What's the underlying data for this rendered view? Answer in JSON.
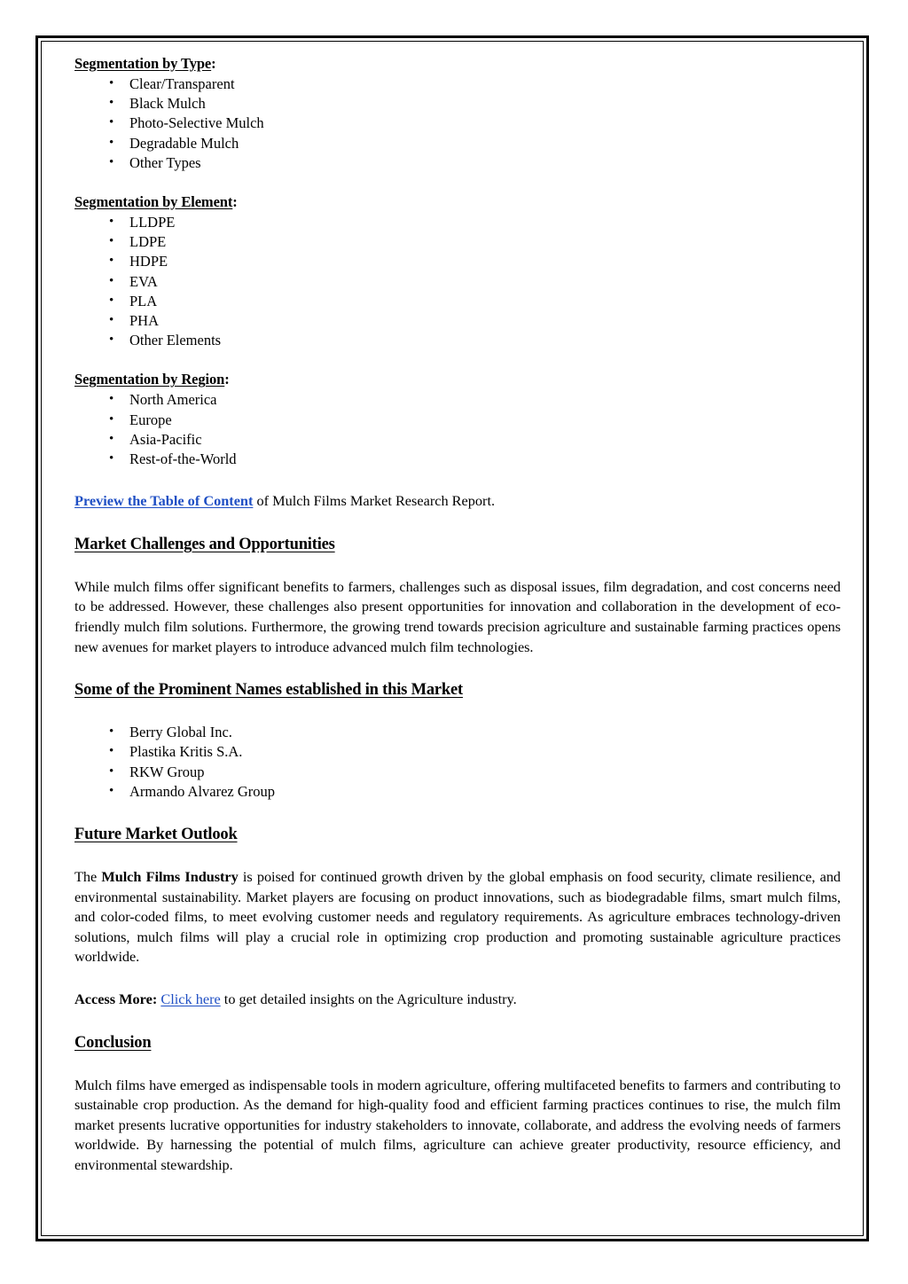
{
  "document": {
    "segmentation_type": {
      "heading": "Segmentation by Type",
      "heading_suffix": ":",
      "items": [
        "Clear/Transparent",
        "Black Mulch",
        "Photo-Selective Mulch",
        "Degradable Mulch",
        "Other Types"
      ]
    },
    "segmentation_element": {
      "heading": "Segmentation by Element",
      "heading_suffix": ":",
      "items": [
        "LLDPE",
        "LDPE",
        "HDPE",
        "EVA",
        "PLA",
        "PHA",
        "Other Elements"
      ]
    },
    "segmentation_region": {
      "heading": "Segmentation by Region",
      "heading_suffix": ":",
      "items": [
        "North America",
        "Europe",
        "Asia-Pacific",
        "Rest-of-the-World"
      ]
    },
    "preview_line": {
      "link_text": "Preview the Table of Content",
      "rest": " of Mulch Films Market Research Report."
    },
    "challenges": {
      "heading": "Market Challenges and Opportunities",
      "paragraph": "While mulch films offer significant benefits to farmers, challenges such as disposal issues, film degradation, and cost concerns need to be addressed. However, these challenges also present opportunities for innovation and collaboration in the development of eco-friendly mulch film solutions. Furthermore, the growing trend towards precision agriculture and sustainable farming practices opens new avenues for market players to introduce advanced mulch film technologies."
    },
    "prominent_names": {
      "heading": "Some of the Prominent Names established in this Market",
      "items": [
        "Berry Global Inc.",
        "Plastika Kritis S.A.",
        "RKW Group",
        "Armando Alvarez Group"
      ]
    },
    "future_outlook": {
      "heading": "Future Market Outlook",
      "paragraph_lead": "The ",
      "paragraph_bold": "Mulch Films Industry",
      "paragraph_rest": " is poised for continued growth driven by the global emphasis on food security, climate resilience, and environmental sustainability. Market players are focusing on product innovations, such as biodegradable films, smart mulch films, and color-coded films, to meet evolving customer needs and regulatory requirements. As agriculture embraces technology-driven solutions, mulch films will play a crucial role in optimizing crop production and promoting sustainable agriculture practices worldwide."
    },
    "access_more": {
      "label": "Access More:",
      "link_text": "Click here",
      "rest": " to get detailed insights on the Agriculture industry."
    },
    "conclusion": {
      "heading": "Conclusion",
      "paragraph": "Mulch films have emerged as indispensable tools in modern agriculture, offering multifaceted benefits to farmers and contributing to sustainable crop production. As the demand for high-quality food and efficient farming practices continues to rise, the mulch film market presents lucrative opportunities for industry stakeholders to innovate, collaborate, and address the evolving needs of farmers worldwide. By harnessing the potential of mulch films, agriculture can achieve greater productivity, resource efficiency, and environmental stewardship."
    },
    "colors": {
      "link": "#1f4fc4",
      "text": "#000000",
      "page_background": "#ffffff",
      "border": "#000000"
    }
  }
}
